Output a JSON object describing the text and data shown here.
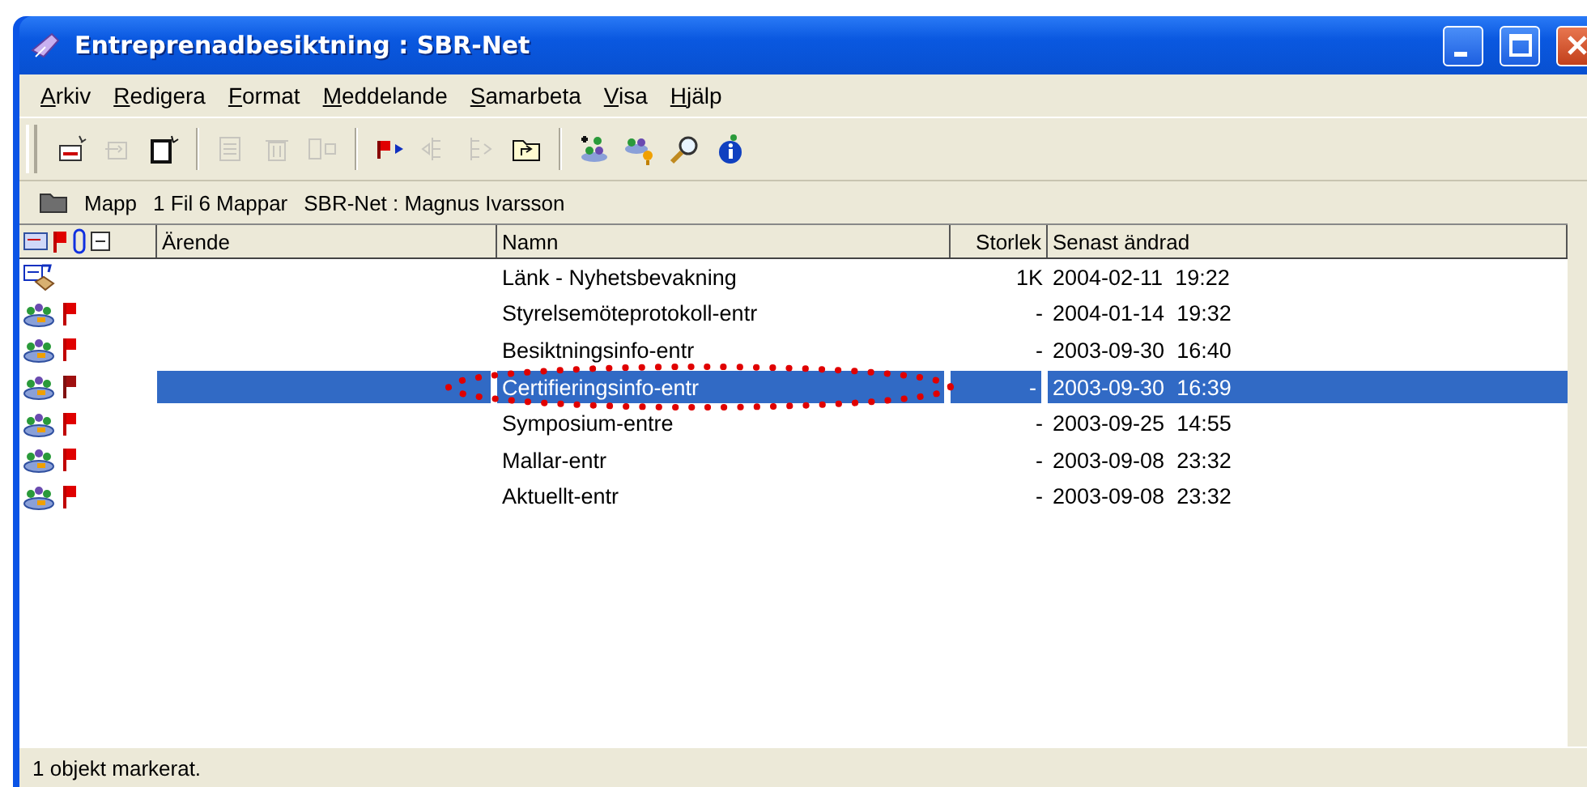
{
  "window": {
    "title": "Entreprenadbesiktning : SBR-Net"
  },
  "menu": [
    "Arkiv",
    "Redigera",
    "Format",
    "Meddelande",
    "Samarbeta",
    "Visa",
    "Hjälp"
  ],
  "toolbar": [
    {
      "kind": "new-message",
      "disabled": false
    },
    {
      "kind": "reply",
      "disabled": true
    },
    {
      "kind": "new-document",
      "disabled": false
    },
    {
      "kind": "separator"
    },
    {
      "kind": "print",
      "disabled": true
    },
    {
      "kind": "delete",
      "disabled": true
    },
    {
      "kind": "move",
      "disabled": true
    },
    {
      "kind": "separator"
    },
    {
      "kind": "flag-next",
      "disabled": false
    },
    {
      "kind": "outdent",
      "disabled": true
    },
    {
      "kind": "indent",
      "disabled": true
    },
    {
      "kind": "folder-up",
      "disabled": false
    },
    {
      "kind": "separator"
    },
    {
      "kind": "add-member",
      "disabled": false
    },
    {
      "kind": "group-key",
      "disabled": false
    },
    {
      "kind": "search",
      "disabled": false
    },
    {
      "kind": "info",
      "disabled": false
    }
  ],
  "location": {
    "type": "Mapp",
    "counts": "1 Fil 6 Mappar",
    "path": "SBR-Net : Magnus Ivarsson"
  },
  "table": {
    "columns": [
      "Ärende",
      "Namn",
      "Storlek",
      "Senast ändrad"
    ],
    "rows": [
      {
        "kind": "link",
        "flagged": false,
        "name": "Länk - Nyhetsbevakning",
        "size": "1K",
        "date": "2004-02-11",
        "time": "19:22",
        "selected": false
      },
      {
        "kind": "group",
        "flagged": true,
        "name": "Styrelsemöteprotokoll-entr",
        "size": "-",
        "date": "2004-01-14",
        "time": "19:32",
        "selected": false
      },
      {
        "kind": "group",
        "flagged": true,
        "name": "Besiktningsinfo-entr",
        "size": "-",
        "date": "2003-09-30",
        "time": "16:40",
        "selected": false
      },
      {
        "kind": "group",
        "flagged": true,
        "name": "Certifieringsinfo-entr",
        "size": "-",
        "date": "2003-09-30",
        "time": "16:39",
        "selected": true
      },
      {
        "kind": "group",
        "flagged": true,
        "name": "Symposium-entre",
        "size": "-",
        "date": "2003-09-25",
        "time": "14:55",
        "selected": false
      },
      {
        "kind": "group",
        "flagged": true,
        "name": "Mallar-entr",
        "size": "-",
        "date": "2003-09-08",
        "time": "23:32",
        "selected": false
      },
      {
        "kind": "group",
        "flagged": true,
        "name": "Aktuellt-entr",
        "size": "-",
        "date": "2003-09-08",
        "time": "23:32",
        "selected": false
      }
    ]
  },
  "status_bar": "1 objekt markerat."
}
